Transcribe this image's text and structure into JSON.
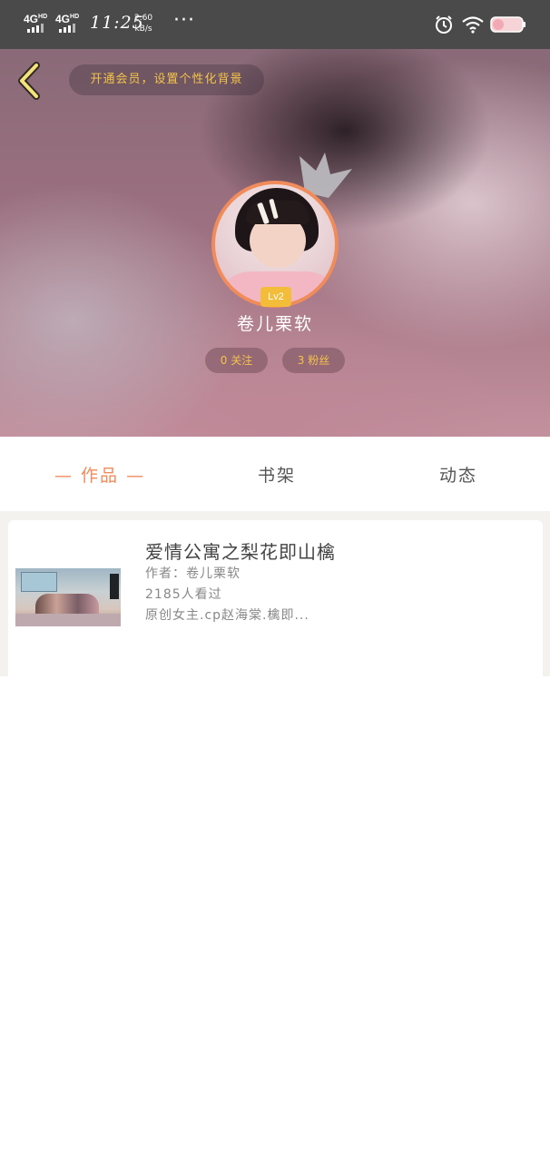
{
  "status_bar": {
    "network1": "4G",
    "network1_sup": "HD",
    "network2": "4G",
    "network2_sup": "HD",
    "time": "11:25",
    "speed_value": "2.60",
    "speed_unit": "kB/s",
    "more": "···",
    "icons": [
      "signal-icon",
      "alarm-icon",
      "wifi-icon",
      "battery-icon"
    ]
  },
  "header": {
    "back_icon": "chevron-left-icon",
    "vip_text": "开通会员，设置个性化背景",
    "level": "Lv2",
    "username": "卷儿栗软",
    "follow_text": "0 关注",
    "fans_text": "3 粉丝"
  },
  "tabs": [
    {
      "label": "— 作品 —",
      "active": true
    },
    {
      "label": "书架",
      "active": false
    },
    {
      "label": "动态",
      "active": false
    }
  ],
  "works": [
    {
      "title": "爱情公寓之梨花即山檎",
      "author": "作者：卷儿栗软",
      "views": "2185人看过",
      "desc": "原创女主.cp赵海棠.檎即..."
    }
  ],
  "colors": {
    "accent": "#f08b5b",
    "gold": "#f3c34a",
    "status_bar": "#4a4a4a"
  }
}
